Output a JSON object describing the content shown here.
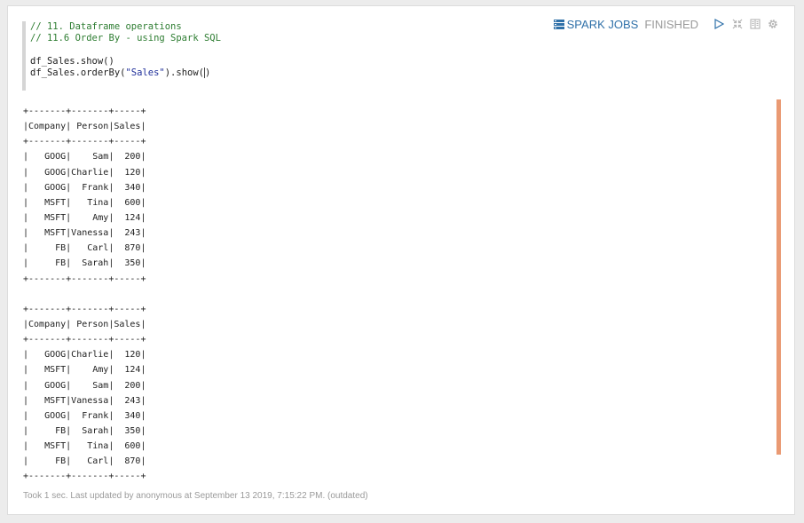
{
  "toolbar": {
    "spark_jobs_label": "SPARK JOBS",
    "status": "FINISHED",
    "icons": [
      "spark-jobs-icon",
      "run-icon",
      "hide-output-icon",
      "book-icon",
      "gear-icon"
    ],
    "accent_color": "#3071a9"
  },
  "editor": {
    "lines": [
      {
        "kind": "comment",
        "text": "// 11. Dataframe operations"
      },
      {
        "kind": "comment",
        "text": "// 11.6 Order By - using Spark SQL"
      },
      {
        "kind": "blank",
        "text": ""
      },
      {
        "kind": "code",
        "text": "df_Sales.show()"
      },
      {
        "kind": "code-mixed",
        "pre": "df_Sales.orderBy(",
        "str": "\"Sales\"",
        "post": ").show(",
        "cursor": ")"
      }
    ]
  },
  "output": {
    "lines": [
      "+-------+-------+-----+",
      "|Company| Person|Sales|",
      "+-------+-------+-----+",
      "|   GOOG|    Sam|  200|",
      "|   GOOG|Charlie|  120|",
      "|   GOOG|  Frank|  340|",
      "|   MSFT|   Tina|  600|",
      "|   MSFT|    Amy|  124|",
      "|   MSFT|Vanessa|  243|",
      "|     FB|   Carl|  870|",
      "|     FB|  Sarah|  350|",
      "+-------+-------+-----+",
      "",
      "+-------+-------+-----+",
      "|Company| Person|Sales|",
      "+-------+-------+-----+",
      "|   GOOG|Charlie|  120|",
      "|   MSFT|    Amy|  124|",
      "|   GOOG|    Sam|  200|",
      "|   MSFT|Vanessa|  243|",
      "|   GOOG|  Frank|  340|",
      "|     FB|  Sarah|  350|",
      "|   MSFT|   Tina|  600|",
      "|     FB|   Carl|  870|",
      "+-------+-------+-----+"
    ],
    "scroll_color": "#ea9a73"
  },
  "footer": {
    "text": "Took 1 sec. Last updated by anonymous at September 13 2019, 7:15:22 PM. (outdated)"
  }
}
